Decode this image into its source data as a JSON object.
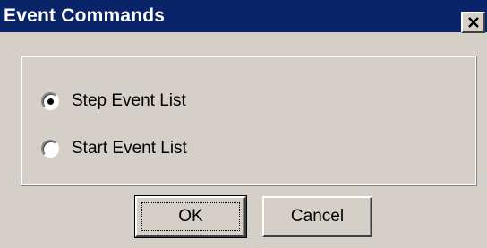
{
  "window": {
    "title": "Event Commands"
  },
  "options": [
    {
      "label": "Step Event List",
      "selected": true
    },
    {
      "label": "Start Event List",
      "selected": false
    }
  ],
  "buttons": {
    "ok_label": "OK",
    "cancel_label": "Cancel"
  },
  "icons": {
    "close": "close-icon"
  },
  "colors": {
    "titlebar": "#0a246a",
    "face": "#d4d0c8"
  }
}
